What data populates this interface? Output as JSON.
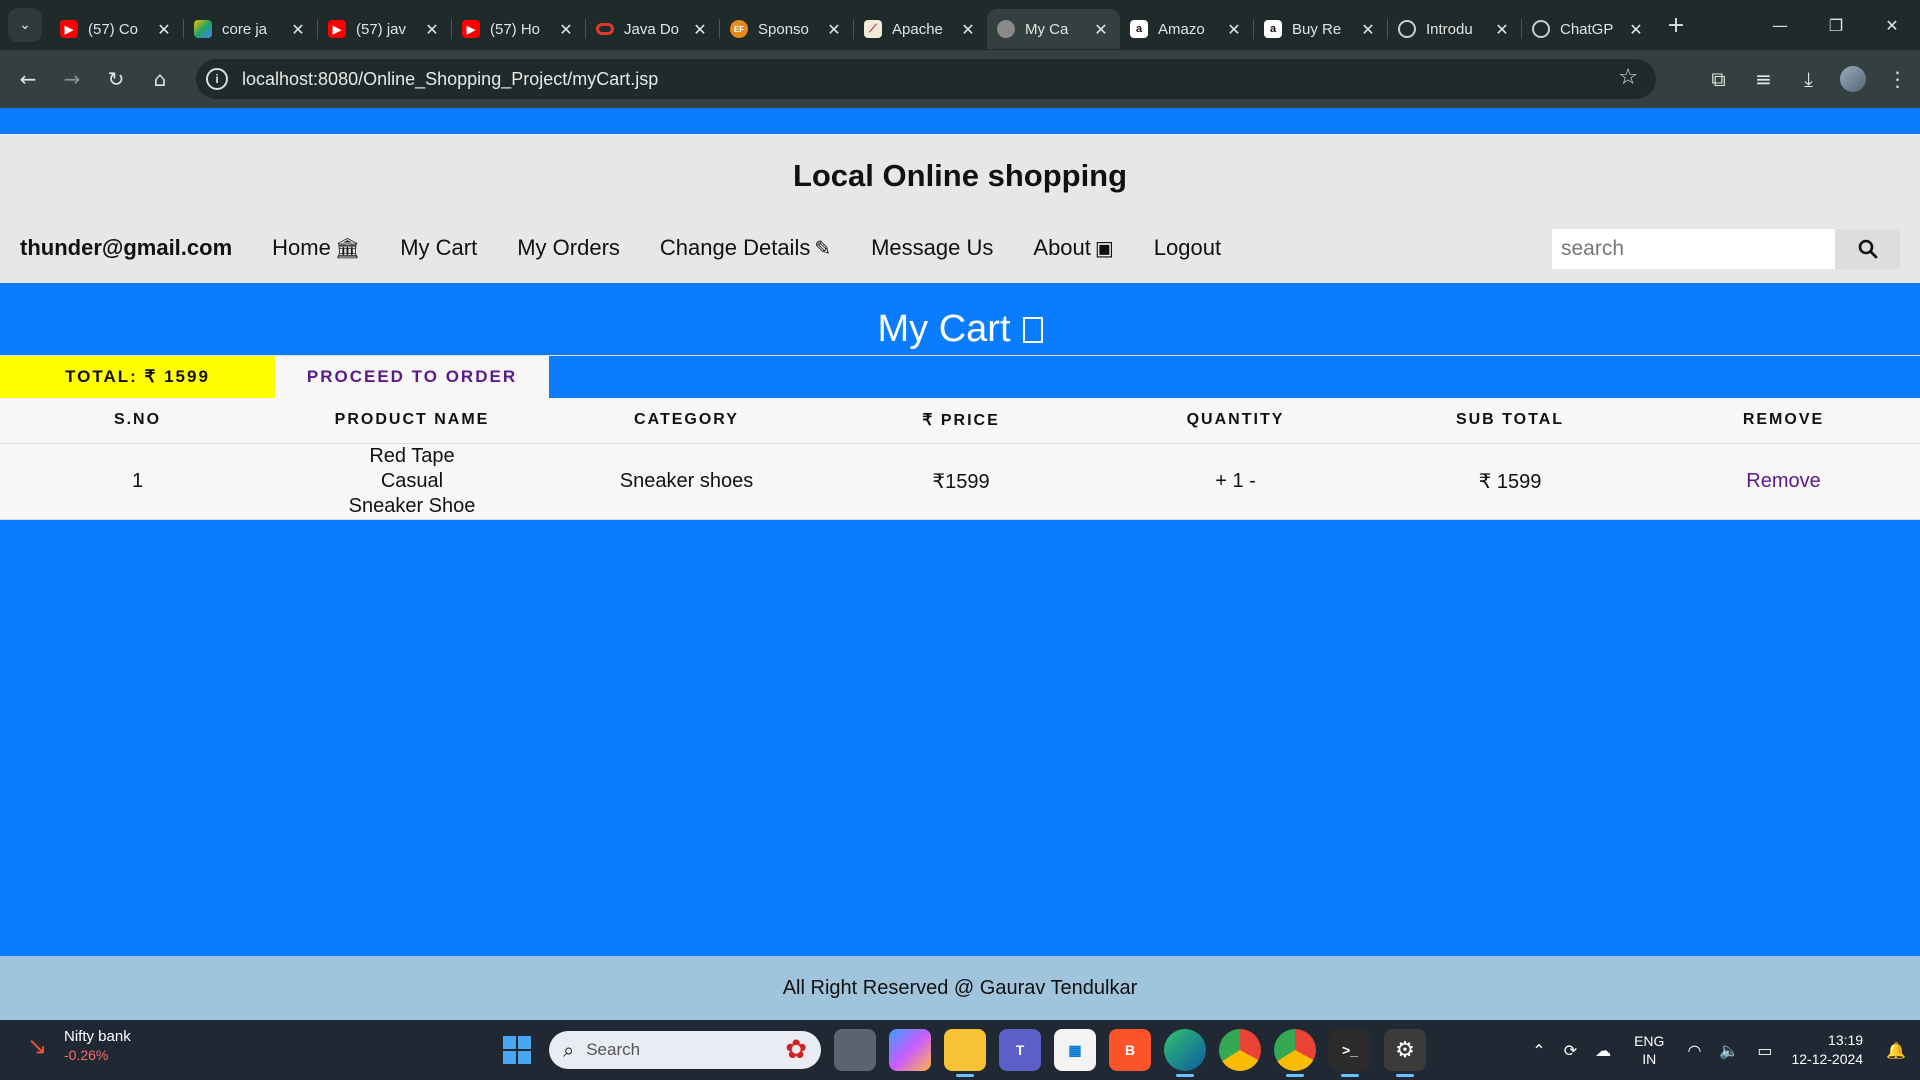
{
  "browser": {
    "tabs": [
      {
        "title": "(57) Co",
        "favicon": "youtube-icon",
        "color": "#ff0000",
        "active": false
      },
      {
        "title": "core ja",
        "favicon": "google-drive-icon",
        "color": "#1fa463",
        "active": false
      },
      {
        "title": "(57) jav",
        "favicon": "youtube-icon",
        "color": "#ff0000",
        "active": false
      },
      {
        "title": "(57) Ho",
        "favicon": "youtube-icon",
        "color": "#ff0000",
        "active": false
      },
      {
        "title": "Java Do",
        "favicon": "oracle-icon",
        "color": "#e0382a",
        "active": false
      },
      {
        "title": "Sponso",
        "favicon": "sponsor-icon",
        "color": "#e88a1a",
        "active": false
      },
      {
        "title": "Apache",
        "favicon": "apache-icon",
        "color": "#c8a05a",
        "active": false
      },
      {
        "title": "My Ca",
        "favicon": "globe-icon",
        "color": "#8a8a8a",
        "active": true
      },
      {
        "title": "Amazo",
        "favicon": "amazon-icon",
        "color": "#ffffff",
        "active": false
      },
      {
        "title": "Buy Re",
        "favicon": "amazon-icon",
        "color": "#ffffff",
        "active": false
      },
      {
        "title": "Introdu",
        "favicon": "openai-icon",
        "color": "#cccccc",
        "active": false
      },
      {
        "title": "ChatGP",
        "favicon": "openai-icon",
        "color": "#cccccc",
        "active": false
      }
    ],
    "url": "localhost:8080/Online_Shopping_Project/myCart.jsp"
  },
  "site": {
    "title": "Local Online shopping",
    "user_email": "thunder@gmail.com",
    "nav": {
      "home": "Home",
      "my_cart": "My Cart",
      "my_orders": "My Orders",
      "change_details": "Change Details",
      "message_us": "Message Us",
      "about": "About",
      "logout": "Logout"
    },
    "search_placeholder": "search"
  },
  "cart": {
    "heading": "My Cart",
    "total_label": "TOTAL: ₹ 1599",
    "proceed_label": "PROCEED TO ORDER",
    "columns": [
      "S.NO",
      "PRODUCT NAME",
      "CATEGORY",
      "₹ PRICE",
      "QUANTITY",
      "SUB TOTAL",
      "REMOVE"
    ],
    "rows": [
      {
        "sno": "1",
        "product": "Red Tape Casual Sneaker Shoe",
        "category": "Sneaker shoes",
        "price": "₹1599",
        "qty_plus": "+",
        "qty": "1",
        "qty_minus": "-",
        "subtotal": "₹ 1599",
        "remove": "Remove"
      }
    ]
  },
  "footer": {
    "text": "All Right Reserved @ Gaurav Tendulkar"
  },
  "taskbar": {
    "widget_name": "Nifty bank",
    "widget_value": "-0.26%",
    "search_label": "Search",
    "lang_line1": "ENG",
    "lang_line2": "IN",
    "time": "13:19",
    "date": "12-12-2024"
  },
  "colors": {
    "page_bg": "#0a7cff",
    "header_bg": "#e7e7e7",
    "total_bg": "#ffff00",
    "link": "#5b1a8b",
    "footer_bg": "#a0c4dc"
  }
}
